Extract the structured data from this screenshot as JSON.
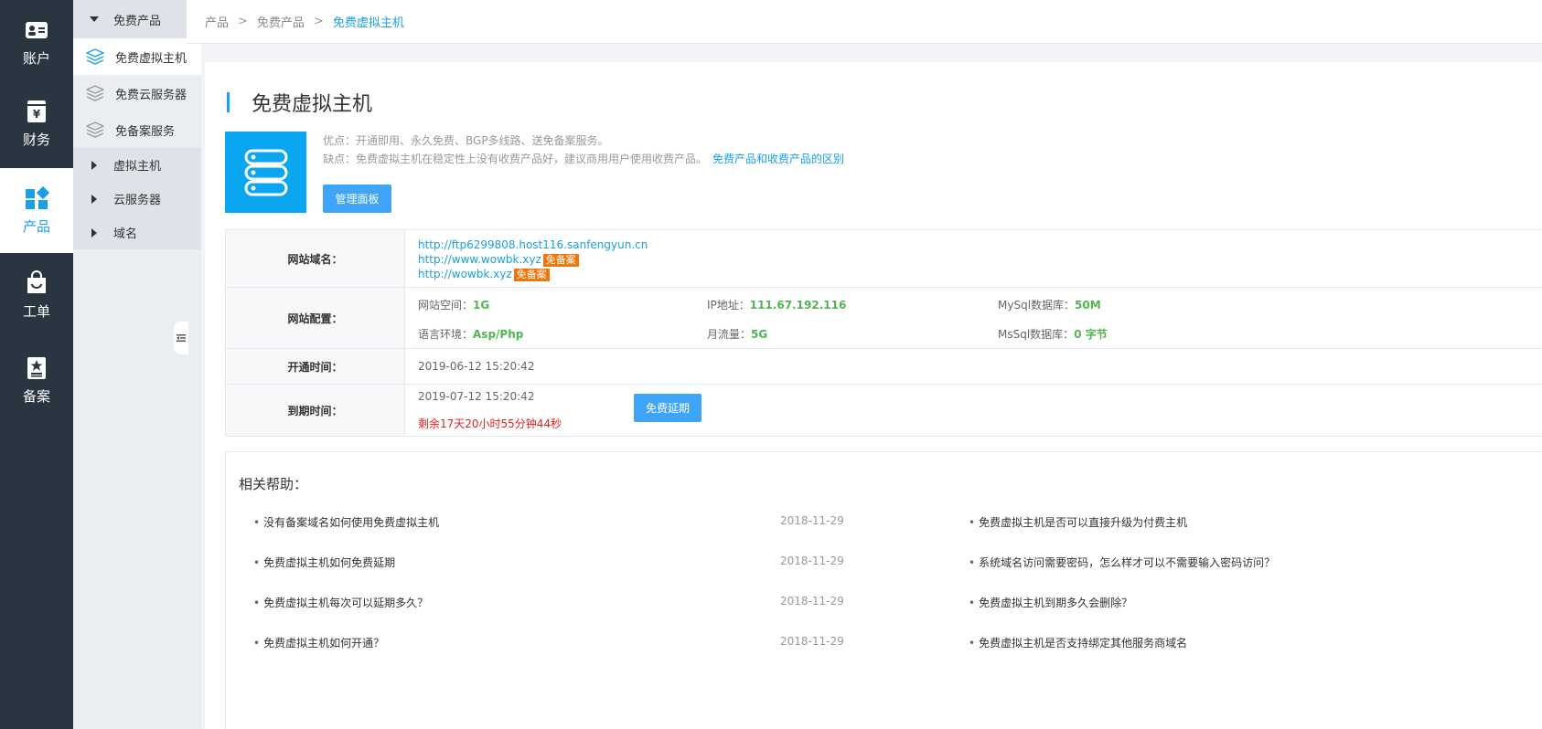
{
  "rail": [
    {
      "label": "账户",
      "icon": "account-icon"
    },
    {
      "label": "财务",
      "icon": "finance-icon"
    },
    {
      "label": "产品",
      "icon": "product-icon",
      "active": true
    },
    {
      "label": "工单",
      "icon": "ticket-icon"
    },
    {
      "label": "备案",
      "icon": "filing-icon"
    }
  ],
  "subnav": {
    "group_free": "免费产品",
    "items": [
      "免费虚拟主机",
      "免费云服务器",
      "免备案服务"
    ],
    "groups": [
      "虚拟主机",
      "云服务器",
      "域名"
    ]
  },
  "breadcrumb": {
    "a": "产品",
    "b": "免费产品",
    "c": "免费虚拟主机",
    "sep": ">"
  },
  "page": {
    "title": "免费虚拟主机",
    "pros": "优点：开通即用、永久免费、BGP多线路、送免备案服务。",
    "cons": "缺点：免费虚拟主机在稳定性上没有收费产品好，建议商用用户使用收费产品。",
    "diff_link": "免费产品和收费产品的区别",
    "manage_btn": "管理面板"
  },
  "info": {
    "domain_label": "网站域名：",
    "domains": [
      {
        "url": "http://ftp6299808.host116.sanfengyun.cn",
        "tag": ""
      },
      {
        "url": "http://www.wowbk.xyz",
        "tag": "免备案"
      },
      {
        "url": "http://wowbk.xyz",
        "tag": "免备案"
      }
    ],
    "config_label": "网站配置：",
    "space_k": "网站空间：",
    "space_v": "1G",
    "ip_k": "IP地址：",
    "ip_v": "111.67.192.116",
    "mysql_k": "MySql数据库：",
    "mysql_v": "50M",
    "lang_k": "语言环境：",
    "lang_v": "Asp/Php",
    "traffic_k": "月流量：",
    "traffic_v": "5G",
    "mssql_k": "MsSql数据库：",
    "mssql_v": "0 字节",
    "open_label": "开通时间：",
    "open_time": "2019-06-12 15:20:42",
    "expire_label": "到期时间：",
    "expire_time": "2019-07-12 15:20:42",
    "remain": "剩余17天20小时55分钟44秒",
    "extend_btn": "免费延期"
  },
  "help": {
    "title": "相关帮助：",
    "rows": [
      {
        "q1": "没有备案域名如何使用免费虚拟主机",
        "d1": "2018-11-29",
        "q2": "免费虚拟主机是否可以直接升级为付费主机"
      },
      {
        "q1": "免费虚拟主机如何免费延期",
        "d1": "2018-11-29",
        "q2": "系统域名访问需要密码，怎么样才可以不需要输入密码访问？"
      },
      {
        "q1": "免费虚拟主机每次可以延期多久？",
        "d1": "2018-11-29",
        "q2": "免费虚拟主机到期多久会删除？"
      },
      {
        "q1": "免费虚拟主机如何开通？",
        "d1": "2018-11-29",
        "q2": "免费虚拟主机是否支持绑定其他服务商域名"
      }
    ]
  },
  "colors": {
    "rail_bg": "#2a3542",
    "accent": "#1a9ee6",
    "tag": "#f0750a",
    "spec_value": "#52b452",
    "remain": "#e02020"
  }
}
